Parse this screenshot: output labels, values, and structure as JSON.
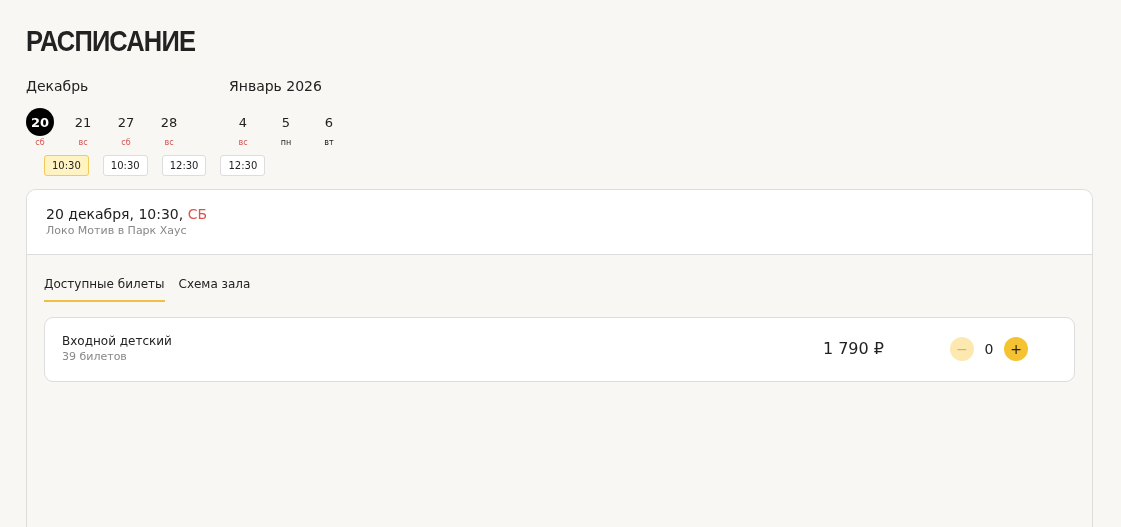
{
  "title": "РАСПИСАНИЕ",
  "months": [
    {
      "name": "Декабрь",
      "days": [
        {
          "day": "20",
          "weekday": "сб",
          "weekend": true,
          "selected": true
        },
        {
          "day": "21",
          "weekday": "вс",
          "weekend": true,
          "selected": false
        },
        {
          "day": "27",
          "weekday": "сб",
          "weekend": true,
          "selected": false
        },
        {
          "day": "28",
          "weekday": "вс",
          "weekend": true,
          "selected": false
        }
      ]
    },
    {
      "name": "Январь 2026",
      "days": [
        {
          "day": "4",
          "weekday": "вс",
          "weekend": true,
          "selected": false
        },
        {
          "day": "5",
          "weekday": "пн",
          "weekend": false,
          "selected": false
        },
        {
          "day": "6",
          "weekday": "вт",
          "weekend": false,
          "selected": false
        }
      ]
    }
  ],
  "times": [
    {
      "label": "10:30",
      "selected": true
    },
    {
      "label": "10:30",
      "selected": false
    },
    {
      "label": "12:30",
      "selected": false
    },
    {
      "label": "12:30",
      "selected": false
    }
  ],
  "session": {
    "date": "20 декабря, 10:30,",
    "weekday": "СБ",
    "venue": "Локо Мотив в Парк Хаус"
  },
  "tabs": [
    {
      "label": "Доступные билеты",
      "selected": true
    },
    {
      "label": "Схема зала",
      "selected": false
    }
  ],
  "tickets": [
    {
      "name": "Входной детский",
      "available": "39 билетов",
      "price": "1 790 ₽",
      "minus": "−",
      "quantity": "0",
      "plus": "+",
      "minus_disabled": true
    }
  ]
}
